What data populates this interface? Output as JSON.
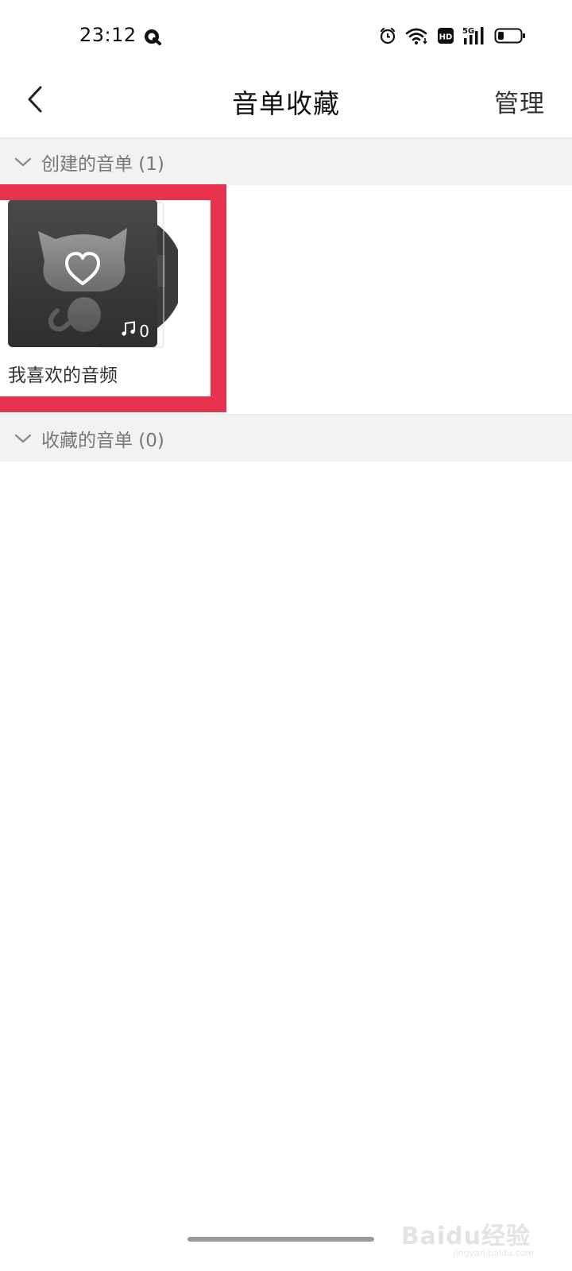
{
  "status_bar": {
    "time": "23:12",
    "app_icon": "q-app-icon",
    "icons": [
      "alarm-icon",
      "wifi-icon",
      "hd-icon",
      "signal-5g-icon",
      "battery-icon"
    ],
    "network_label": "5G",
    "hd_label": "HD"
  },
  "nav": {
    "back_icon": "chevron-left-icon",
    "title": "音单收藏",
    "manage_label": "管理"
  },
  "sections": {
    "created": {
      "label": "创建的音单 (1)",
      "expanded": true
    },
    "collected": {
      "label": "收藏的音单 (0)",
      "expanded": true
    }
  },
  "playlists": [
    {
      "name": "我喜欢的音频",
      "track_count": "0",
      "cover_icon": "cat-heart-icon",
      "highlighted": true
    }
  ],
  "colors": {
    "highlight": "#e8334f",
    "section_bg": "#f2f2f2",
    "cover_bg": "#3a3a3a"
  },
  "watermark": {
    "text": "Baidu经验",
    "sub": "jingyan.baidu.com"
  }
}
